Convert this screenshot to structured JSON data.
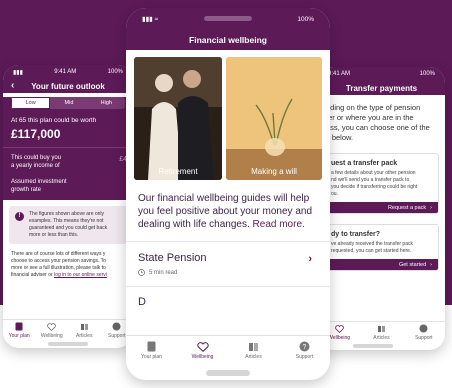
{
  "left_phone": {
    "status_time": "9:41 AM",
    "status_battery": "100%",
    "title": "Your future outlook",
    "segments": [
      "Low",
      "Mid",
      "High"
    ],
    "worth_text": "At 65 this plan could be worth",
    "worth_value": "£117,000",
    "buy_text_1": "This could buy you",
    "buy_text_2": "a yearly income of",
    "buy_side_value": "£4",
    "assumed_1": "Assumed investment",
    "assumed_2": "growth rate",
    "note_1": "The figures shown above are only",
    "note_2": "examples. This means they're not",
    "note_3": "guaranteed and you could get back",
    "note_4": "more or less than this.",
    "para_1": "There are of course lots of different ways y",
    "para_2": "choose to access your pension savings. To",
    "para_3": "more or see a full illustration, please talk to",
    "para_4": "financial adviser or ",
    "para_link": "log in to our online servi",
    "tabs": [
      "Your plan",
      "Wellbeing",
      "Articles",
      "Support"
    ]
  },
  "center_phone": {
    "status_time": "9:41 AM",
    "status_battery": "100%",
    "title": "Financial wellbeing",
    "image_1_caption": "Retirement",
    "image_2_caption": "Making a will",
    "lead_text": "Our financial wellbeing guides will help you feel positive about your money and dealing with life changes. ",
    "read_more": "Read more",
    "read_more_end": ".",
    "item_title": "State Pension",
    "item_meta": "5 min read",
    "peek_text": "D",
    "tabs": [
      "Your plan",
      "Wellbeing",
      "Articles",
      "Support"
    ]
  },
  "right_phone": {
    "status_time": "9:41 AM",
    "status_battery": "100%",
    "title": "Transfer payments",
    "text_1": "nding on the type of pension",
    "text_2": "fer or where you are in the",
    "text_3": "ess, you can choose one of the",
    "text_4": "s below.",
    "card1_title": "uest a transfer pack",
    "card1_body_1": "a few details about your other pension",
    "card1_body_2": "nd we'll send you a transfer pack to",
    "card1_body_3": "you decide if transferring could be right",
    "card1_body_4": "ou.",
    "card1_button": "Request a pack",
    "card2_title": "dy to transfer?",
    "card2_body_1": "ve already received the transfer pack",
    "card2_body_2": "requested, you can get started here.",
    "card2_button": "Get started",
    "tabs": [
      "Wellbeing",
      "Articles",
      "Support"
    ]
  },
  "colors": {
    "brand_purple": "#5c1a57",
    "text_dark": "#3b1f46"
  }
}
